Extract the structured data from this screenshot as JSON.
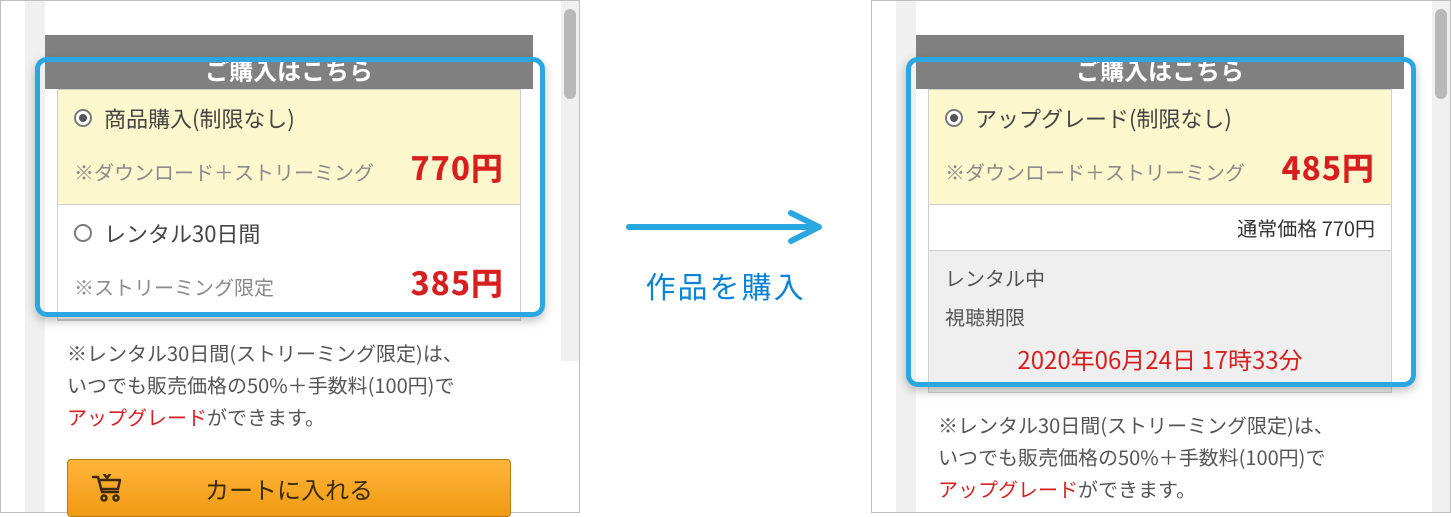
{
  "banner": "ご購入はこちら",
  "left": {
    "opt1": {
      "title": "商品購入(制限なし)",
      "sub": "※ダウンロード＋ストリーミング",
      "price": "770円"
    },
    "opt2": {
      "title": "レンタル30日間",
      "sub": "※ストリーミング限定",
      "price": "385円"
    },
    "cart_label": "カートに入れる"
  },
  "right": {
    "opt1": {
      "title": "アップグレード(制限なし)",
      "sub": "※ダウンロード＋ストリーミング",
      "price": "485円"
    },
    "reg_price": "通常価格 770円",
    "status": {
      "renting": "レンタル中",
      "deadline_label": "視聴期限",
      "deadline": "2020年06月24日 17時33分"
    }
  },
  "note": {
    "l1": "※レンタル30日間(ストリーミング限定)は、",
    "l2": "いつでも販売価格の50%＋手数料(100円)で",
    "up": "アップグレード",
    "l3": "ができます。"
  },
  "mid_caption": "作品を購入"
}
